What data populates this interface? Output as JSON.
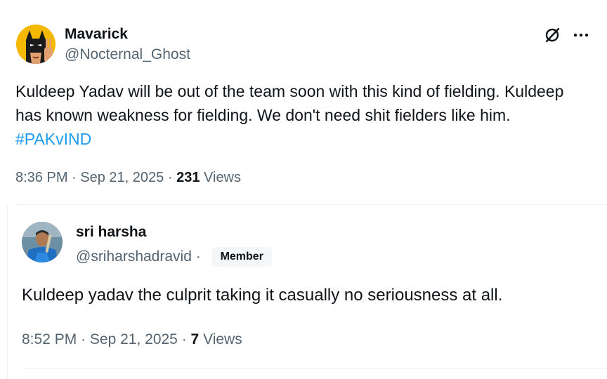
{
  "tweet": {
    "display_name": "Mavarick",
    "handle": "@Nocternal_Ghost",
    "text_main": "Kuldeep Yadav will be out of the team soon with this kind of fielding. Kuldeep has known weakness for fielding. We don't need shit fielders like him.",
    "hashtag": "#PAKvIND",
    "time": "8:36 PM",
    "date": "Sep 21, 2025",
    "views_count": "231",
    "views_label": "Views",
    "avatar_icon": "batman-avatar",
    "grok_icon": "grok-icon",
    "more_icon": "more-icon"
  },
  "reply": {
    "display_name": "sri harsha",
    "handle": "@sriharshadravid",
    "badge": "Member",
    "text": "Kuldeep yadav the culprit taking it casually no seriousness at all.",
    "time": "8:52 PM",
    "date": "Sep 21, 2025",
    "views_count": "7",
    "views_label": "Views",
    "avatar_icon": "cricketer-avatar"
  },
  "separator": "·",
  "colors": {
    "text": "#0f1419",
    "secondary": "#536471",
    "link": "#1d9bf0",
    "border": "#eff3f4"
  }
}
